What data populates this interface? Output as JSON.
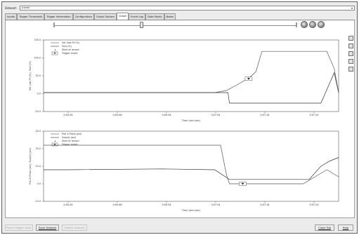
{
  "dataset": {
    "label": "Dataset:",
    "value": "(none)"
  },
  "tabs": [
    {
      "label": "Inputs",
      "active": false
    },
    {
      "label": "Trigger Thresholds",
      "active": false
    },
    {
      "label": "Trigger Information",
      "active": false
    },
    {
      "label": "Configuration",
      "active": false
    },
    {
      "label": "Graph Options",
      "active": false
    },
    {
      "label": "Graph",
      "active": true
    },
    {
      "label": "Event Log",
      "active": false
    },
    {
      "label": "Data Points",
      "active": false
    },
    {
      "label": "Notes",
      "active": false
    }
  ],
  "slider": {
    "position_fraction": 0.36
  },
  "toolbar_buttons": [
    {
      "icon": "zoom-in-icon"
    },
    {
      "icon": "zoom-out-icon"
    },
    {
      "icon": "zoom-reset-icon"
    }
  ],
  "side_icons": [
    "chart-icon",
    "grid-icon",
    "list-icon",
    "export-icon",
    "print-icon"
  ],
  "chart_data": [
    {
      "type": "line",
      "ylabel": "Set Last Pt (%), Fact (%)",
      "xlabel": "Time (mm:sec)",
      "ylim": [
        -20,
        150
      ],
      "yticks": [
        "150.0",
        "100.0",
        "50.0",
        "0.0",
        "-20.0"
      ],
      "xticks": [
        "0:00:34",
        "0:00:46",
        "0:00:54",
        "0:07:04",
        "0:07:14",
        "0:07:24"
      ],
      "legend": [
        "Set Last Pt (%)",
        "Fact (%)",
        "Start of record",
        "Trigger event"
      ],
      "legend_position": "top-left",
      "grid": false,
      "series": [
        {
          "name": "Set Last Pt (%)",
          "x": [
            0,
            0.58,
            0.62,
            0.66,
            0.7,
            0.72,
            0.74,
            0.96,
            0.985,
            1.0
          ],
          "y": [
            25,
            25,
            30,
            45,
            62,
            75,
            123,
            123,
            82,
            25
          ]
        },
        {
          "name": "Fact (%)",
          "x": [
            0,
            0.58,
            0.625,
            0.63,
            0.9,
            0.94,
            0.965,
            0.985,
            1.0
          ],
          "y": [
            25,
            25,
            25,
            0,
            0,
            0,
            40,
            72,
            25
          ]
        }
      ],
      "trigger_marker_x": 0.695
    },
    {
      "type": "line",
      "ylabel": "Prol A Press (psi), Supply (psi)",
      "xlabel": "Time (mm:sec)",
      "ylim": [
        -10,
        30
      ],
      "yticks": [
        "30.0",
        "20.0",
        "10.0",
        "0.0",
        "-10.0"
      ],
      "xticks": [
        "0:00:34",
        "0:00:46",
        "0:00:54",
        "0:07:04",
        "0:07:14",
        "0:07:24"
      ],
      "legend": [
        "Prol A Press (psi)",
        "Supply (psi)",
        "Start of record",
        "Trigger event"
      ],
      "legend_position": "top-left",
      "grid": false,
      "series": [
        {
          "name": "Prol A Press (psi)",
          "x": [
            0,
            0.5,
            0.6,
            0.6,
            0.62,
            0.63,
            0.88,
            0.92,
            0.96,
            1.0
          ],
          "y": [
            22,
            22,
            22,
            22,
            5,
            0,
            0,
            4,
            8,
            4
          ],
          "smoothing": "segment"
        },
        {
          "name": "Supply (psi)",
          "x": [
            0,
            0.08,
            0.4,
            0.58,
            0.63,
            0.9,
            0.94,
            0.97,
            1.0
          ],
          "y": [
            8,
            8,
            8.5,
            8,
            2.5,
            2.5,
            10,
            13,
            15
          ]
        }
      ],
      "trigger_marker_x": 0.675
    }
  ],
  "buttons": {
    "reset_trigger": "Reset Trigger Data",
    "save_dataset": "Save Dataset",
    "delete_dataset": "Delete Dataset",
    "close_tab": "Close Tab",
    "help": "Help"
  }
}
